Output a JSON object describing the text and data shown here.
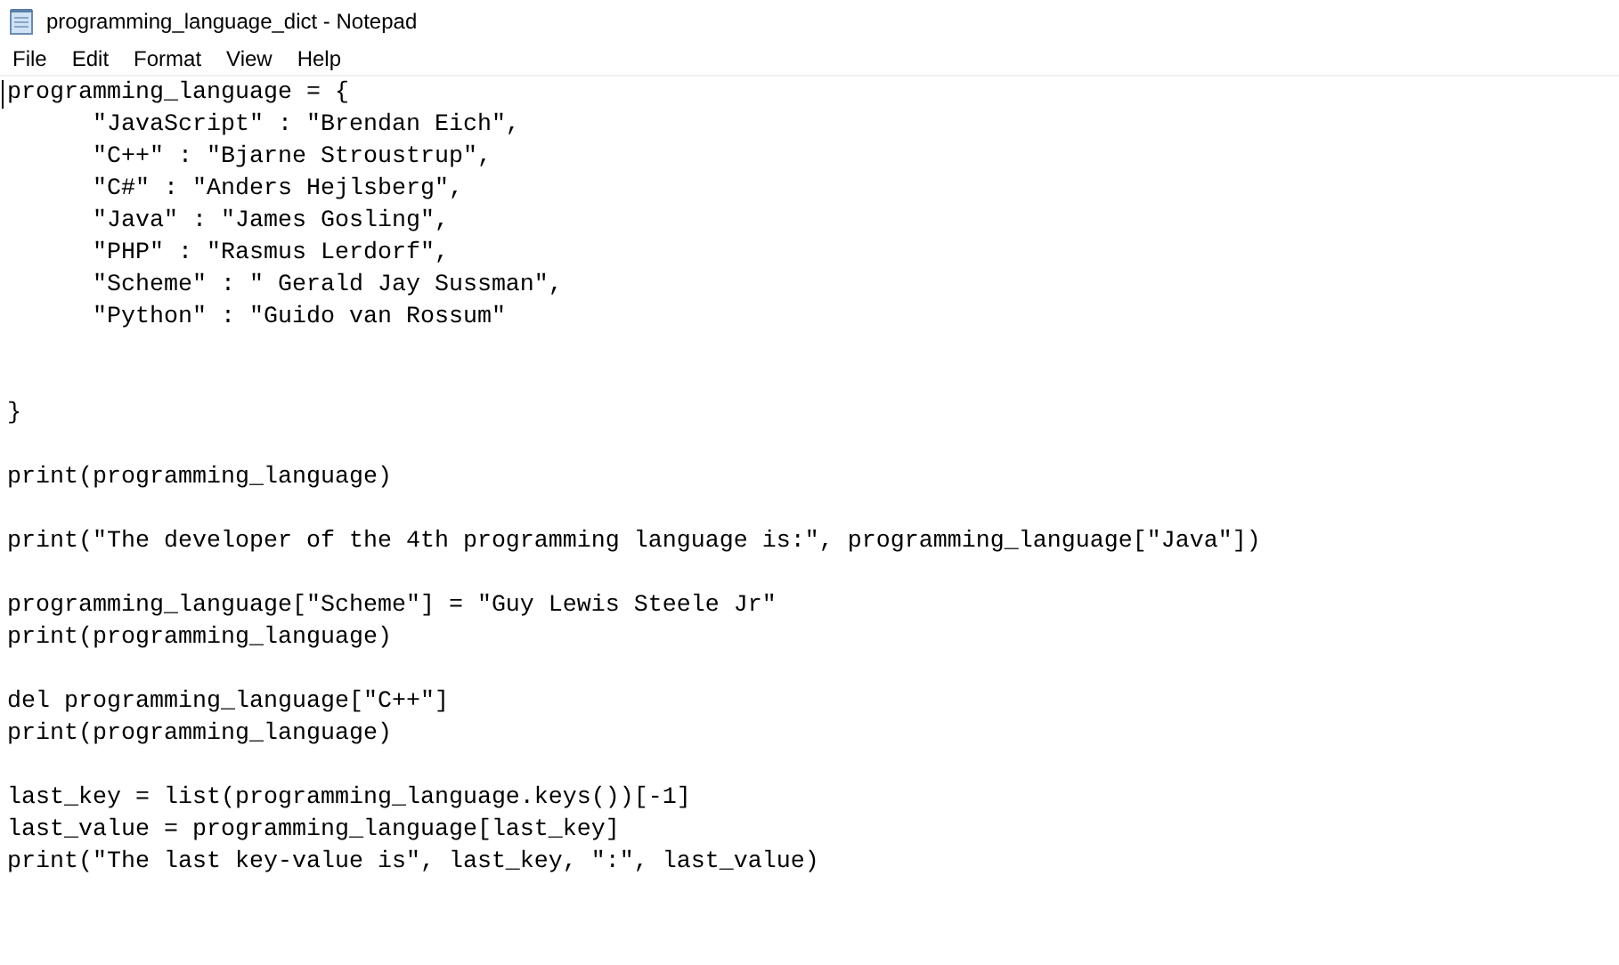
{
  "window": {
    "title": "programming_language_dict - Notepad"
  },
  "menu": [
    "File",
    "Edit",
    "Format",
    "View",
    "Help"
  ],
  "editor": {
    "lines": [
      {
        "kind": "code",
        "text": "programming_language = {"
      },
      {
        "kind": "code",
        "text": "      \"JavaScript\" : \"Brendan Eich\","
      },
      {
        "kind": "code",
        "text": "      \"C++\" : \"Bjarne Stroustrup\","
      },
      {
        "kind": "code",
        "text": "      \"C#\" : \"Anders Hejlsberg\","
      },
      {
        "kind": "code",
        "text": "      \"Java\" : \"James Gosling\","
      },
      {
        "kind": "code",
        "text": "      \"PHP\" : \"Rasmus Lerdorf\","
      },
      {
        "kind": "code",
        "text": "      \"Scheme\" : \" Gerald Jay Sussman\","
      },
      {
        "kind": "code",
        "text": "      \"Python\" : \"Guido van Rossum\""
      },
      {
        "kind": "blank"
      },
      {
        "kind": "blank"
      },
      {
        "kind": "code",
        "text": "}"
      },
      {
        "kind": "blank"
      },
      {
        "kind": "code",
        "text": "print(programming_language)"
      },
      {
        "kind": "blank"
      },
      {
        "kind": "code",
        "text": "print(\"The developer of the 4th programming language is:\", programming_language[\"Java\"])"
      },
      {
        "kind": "blank"
      },
      {
        "kind": "code",
        "text": "programming_language[\"Scheme\"] = \"Guy Lewis Steele Jr\""
      },
      {
        "kind": "code",
        "text": "print(programming_language)"
      },
      {
        "kind": "blank"
      },
      {
        "kind": "code",
        "text": "del programming_language[\"C++\"]"
      },
      {
        "kind": "code",
        "text": "print(programming_language)"
      },
      {
        "kind": "blank"
      },
      {
        "kind": "code",
        "text": "last_key = list(programming_language.keys())[-1]"
      },
      {
        "kind": "code",
        "text": "last_value = programming_language[last_key]"
      },
      {
        "kind": "code",
        "text": "print(\"The last key-value is\", last_key, \":\", last_value)"
      }
    ]
  }
}
